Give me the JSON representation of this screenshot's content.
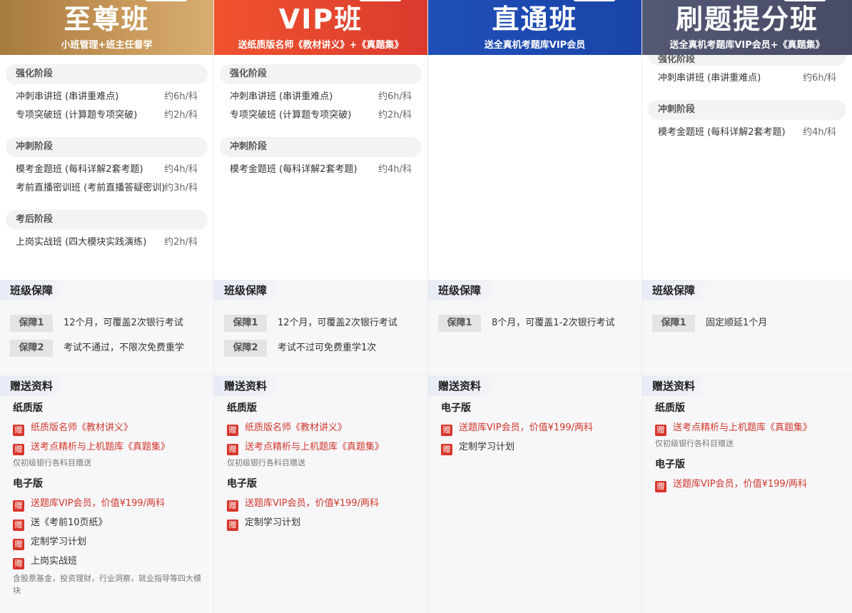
{
  "columns": [
    {
      "title": "至尊班",
      "subtitle": "小班管理+班主任督学",
      "stages": [
        {
          "name": "强化阶段",
          "items": [
            {
              "name": "冲刺串讲班 (串讲重难点)",
              "dur": "约6h/科"
            },
            {
              "name": "专项突破班 (计算题专项突破)",
              "dur": "约2h/科"
            }
          ]
        },
        {
          "name": "冲刺阶段",
          "items": [
            {
              "name": "模考金题班 (每科详解2套考题)",
              "dur": "约4h/科"
            },
            {
              "name": "考前直播密训班 (考前直播答疑密训)",
              "dur": "约3h/科"
            }
          ]
        },
        {
          "name": "考后阶段",
          "items": [
            {
              "name": "上岗实战班 (四大模块实践演练)",
              "dur": "约2h/科"
            }
          ]
        }
      ],
      "guarantee": [
        {
          "label": "保障1",
          "text": "12个月，可覆盖2次银行考试"
        },
        {
          "label": "保障2",
          "text": "考试不通过，不限次免费重学"
        }
      ],
      "gifts": {
        "paper_heading": "纸质版",
        "paper": [
          "纸质版名师《教材讲义》",
          "送考点精析与上机题库《真题集》"
        ],
        "paper_note": "仅初级银行各科目赠送",
        "e_heading": "电子版",
        "e": [
          "送题库VIP会员，价值¥199/两科",
          "送《考前10页纸》",
          "定制学习计划",
          "上岗实战班"
        ],
        "e_note": "含股票基金，投资理财，行业洞察，就业指导等四大模块"
      }
    },
    {
      "title": "VIP班",
      "subtitle": "送纸质版名师《教材讲义》+《真题集》",
      "stages": [
        {
          "name": "强化阶段",
          "items": [
            {
              "name": "冲刺串讲班 (串讲重难点)",
              "dur": "约6h/科"
            },
            {
              "name": "专项突破班 (计算题专项突破)",
              "dur": "约2h/科"
            }
          ]
        },
        {
          "name": "冲刺阶段",
          "items": [
            {
              "name": "模考金题班 (每科详解2套考题)",
              "dur": "约4h/科"
            }
          ]
        }
      ],
      "guarantee": [
        {
          "label": "保障1",
          "text": "12个月，可覆盖2次银行考试"
        },
        {
          "label": "保障2",
          "text": "考试不过可免费重学1次"
        }
      ],
      "gifts": {
        "paper_heading": "纸质版",
        "paper": [
          "纸质版名师《教材讲义》",
          "送考点精析与上机题库《真题集》"
        ],
        "paper_note": "仅初级银行各科目赠送",
        "e_heading": "电子版",
        "e": [
          "送题库VIP会员，价值¥199/两科",
          "定制学习计划"
        ]
      }
    },
    {
      "title": "直通班",
      "subtitle": "送全真机考题库VIP会员",
      "stages": [],
      "guarantee": [
        {
          "label": "保障1",
          "text": "8个月，可覆盖1-2次银行考试"
        }
      ],
      "gifts": {
        "e_heading": "电子版",
        "e": [
          "送题库VIP会员，价值¥199/两科",
          "定制学习计划"
        ]
      }
    },
    {
      "title": "刷题提分班",
      "subtitle": "送全真机考题库VIP会员+《真题集》",
      "stages": [
        {
          "name": "强化阶段",
          "items": [
            {
              "name": "冲刺串讲班 (串讲重难点)",
              "dur": "约6h/科"
            }
          ]
        },
        {
          "name": "冲刺阶段",
          "items": [
            {
              "name": "模考金题班 (每科详解2套考题)",
              "dur": "约4h/科"
            }
          ]
        }
      ],
      "guarantee": [
        {
          "label": "保障1",
          "text": "固定顺延1个月"
        }
      ],
      "gifts": {
        "paper_heading": "纸质版",
        "paper": [
          "送考点精析与上机题库《真题集》"
        ],
        "paper_note": "仅初级银行各科目赠送",
        "e_heading": "电子版",
        "e": [
          "送题库VIP会员，价值¥199/两科"
        ]
      }
    }
  ],
  "labels": {
    "guarantee_section": "班级保障",
    "gifts_section": "赠送资料",
    "gift_badge": "赠"
  }
}
